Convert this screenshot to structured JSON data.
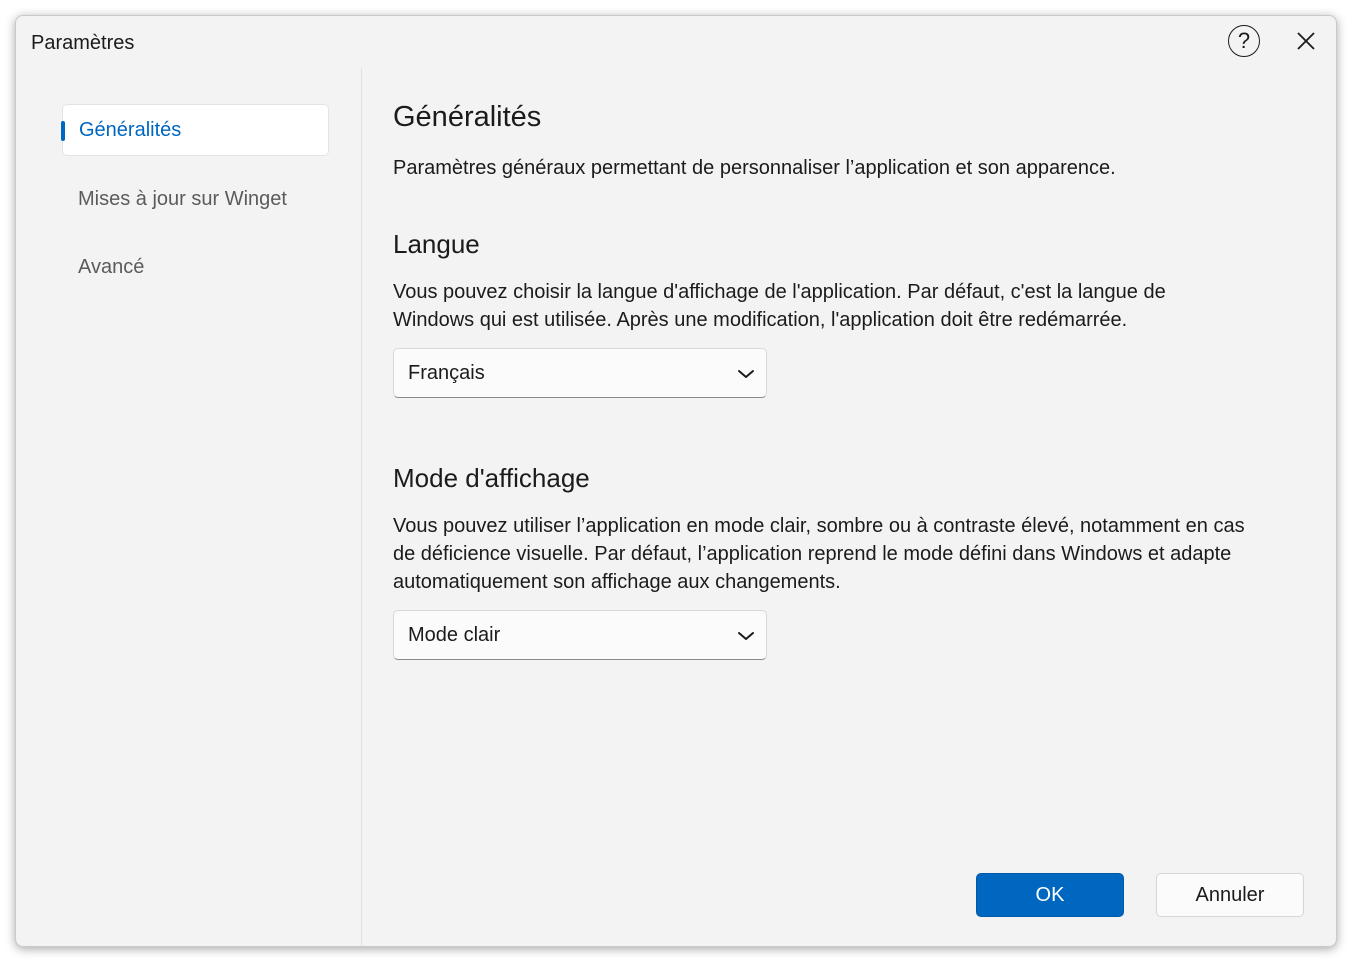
{
  "window": {
    "title": "Paramètres",
    "help_glyph": "?",
    "icons": {
      "help": "help-circle-icon",
      "close": "close-icon"
    }
  },
  "sidebar": {
    "items": [
      {
        "label": "Généralités",
        "active": true
      },
      {
        "label": "Mises à jour sur Winget",
        "active": false
      },
      {
        "label": "Avancé",
        "active": false
      }
    ]
  },
  "main": {
    "title": "Généralités",
    "description": "Paramètres généraux permettant de personnaliser l’application et son apparence.",
    "language": {
      "heading": "Langue",
      "description": "Vous pouvez choisir la langue d'affichage de l'application. Par défaut, c'est la langue de Windows qui est utilisée. Après une modification, l'application doit être redémarrée.",
      "selected": "Français"
    },
    "display_mode": {
      "heading": "Mode d'affichage",
      "description": "Vous pouvez utiliser l’application en mode clair, sombre ou à contraste élevé, notamment en cas de déficience visuelle. Par défaut, l’application reprend le mode défini dans Windows et adapte automatiquement son affichage aux changements.",
      "selected": "Mode clair"
    }
  },
  "footer": {
    "ok_label": "OK",
    "cancel_label": "Annuler"
  },
  "colors": {
    "accent": "#0067c0",
    "background": "#f3f3f3",
    "card": "#ffffff"
  }
}
